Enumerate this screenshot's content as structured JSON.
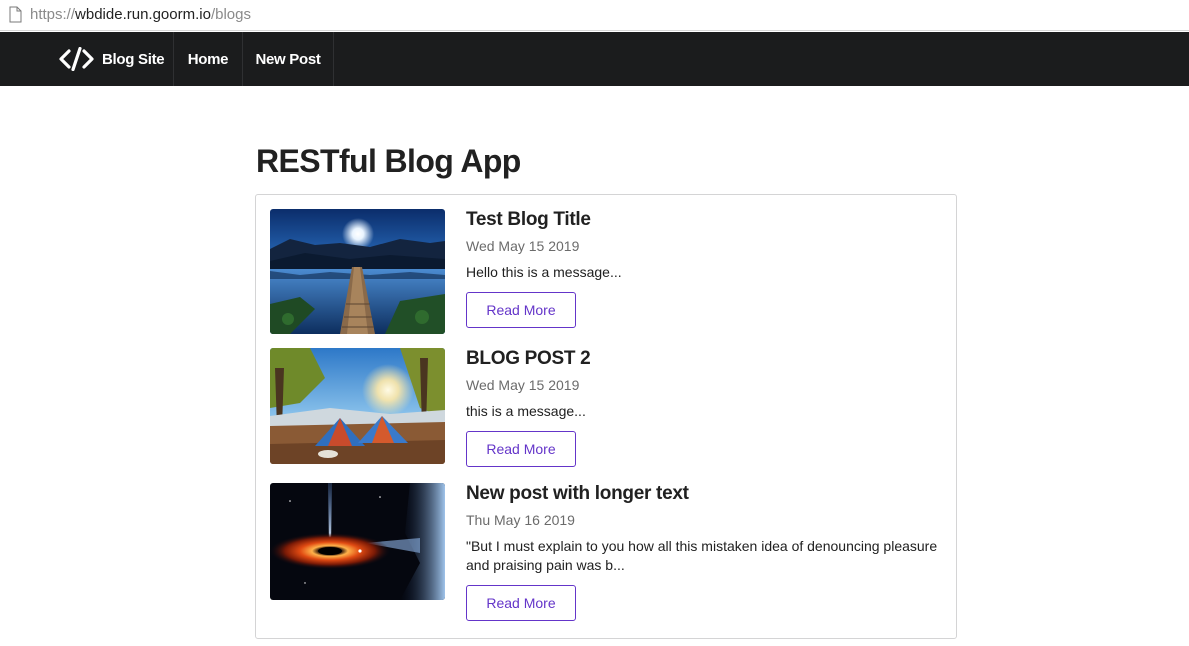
{
  "browser": {
    "url_scheme": "https://",
    "url_host": "wbdide.run.goorm.io",
    "url_path": "/blogs"
  },
  "navbar": {
    "brand_label": "Blog Site",
    "items": [
      {
        "label": "Home"
      },
      {
        "label": "New Post"
      }
    ],
    "background": "#1b1c1d"
  },
  "page": {
    "title": "RESTful Blog App"
  },
  "posts": [
    {
      "title": "Test Blog Title",
      "date": "Wed May 15 2019",
      "excerpt": "Hello this is a message...",
      "button_label": "Read More",
      "image": "lake-pier-moonlight"
    },
    {
      "title": "BLOG POST 2",
      "date": "Wed May 15 2019",
      "excerpt": "this is a message...",
      "button_label": "Read More",
      "image": "tents-forest-sunrise"
    },
    {
      "title": "New post with longer text",
      "date": "Thu May 16 2019",
      "excerpt": "\"But I must explain to you how all this mistaken idea of denouncing pleasure and praising pain was b...",
      "button_label": "Read More",
      "image": "black-hole-accretion-disk"
    }
  ],
  "colors": {
    "accent": "#6435c9",
    "text": "#212121",
    "meta": "#6b6b6b"
  }
}
